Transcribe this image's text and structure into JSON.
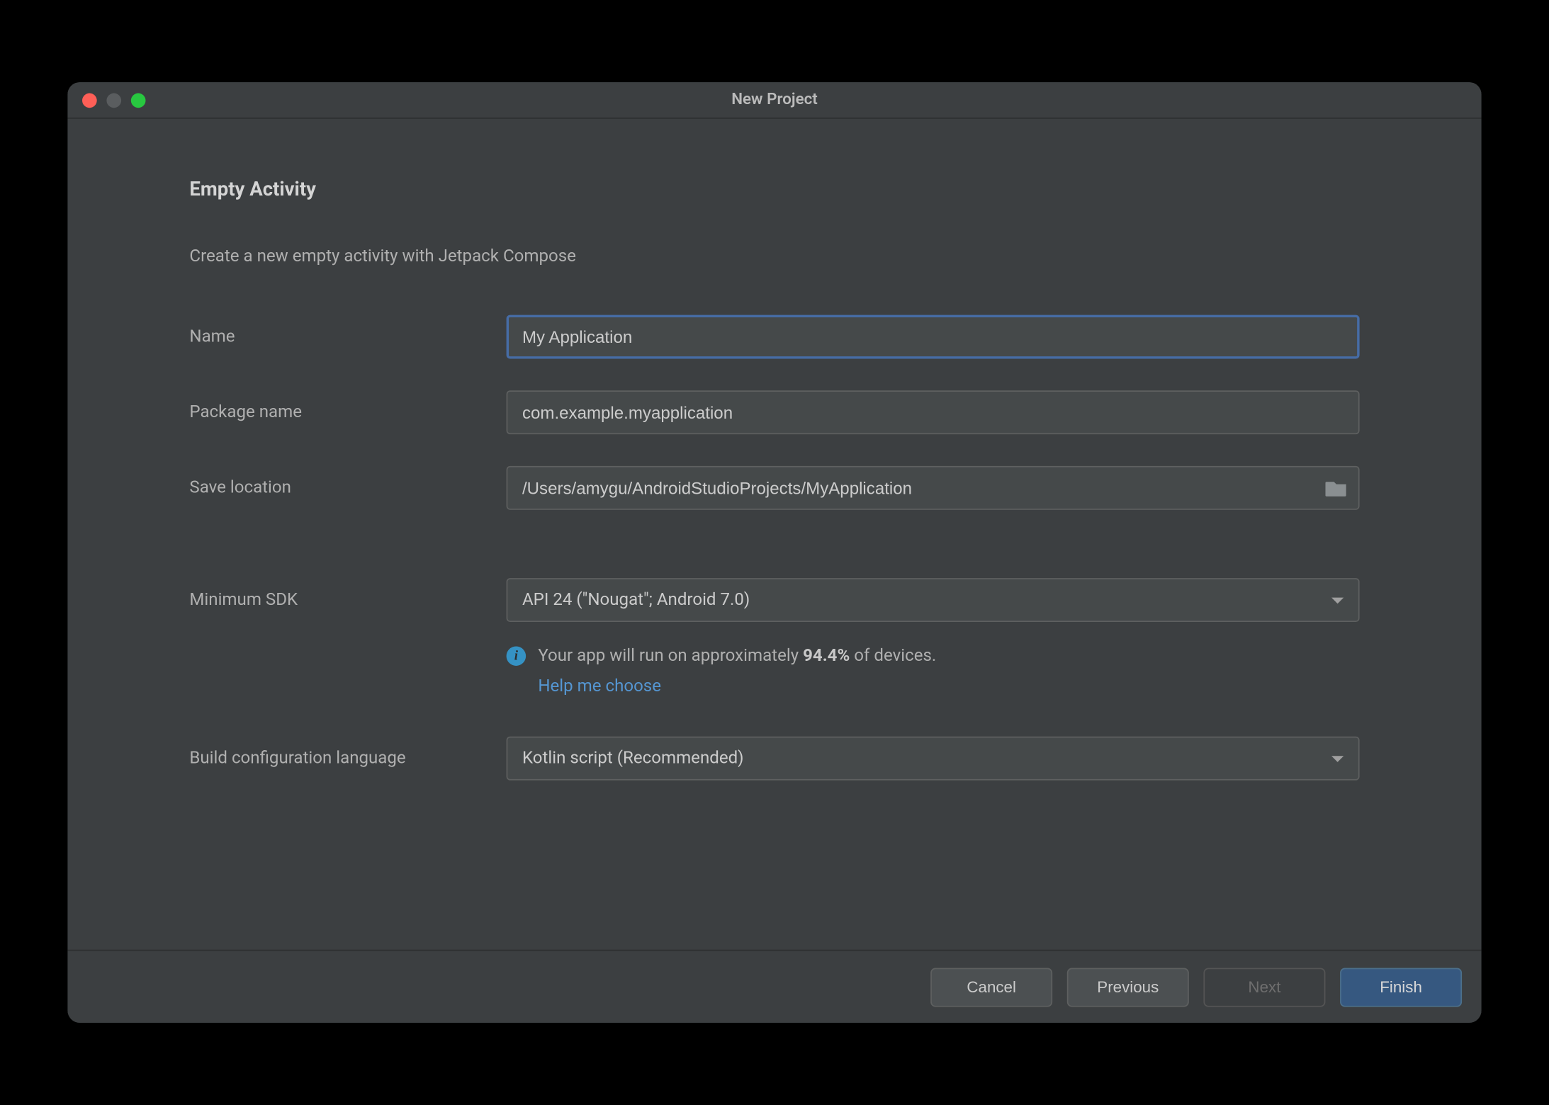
{
  "window": {
    "title": "New Project"
  },
  "header": {
    "heading": "Empty Activity",
    "description": "Create a new empty activity with Jetpack Compose"
  },
  "form": {
    "name": {
      "label": "Name",
      "value": "My Application"
    },
    "package_name": {
      "label": "Package name",
      "value": "com.example.myapplication"
    },
    "save_location": {
      "label": "Save location",
      "value": "/Users/amygu/AndroidStudioProjects/MyApplication"
    },
    "minimum_sdk": {
      "label": "Minimum SDK",
      "value": "API 24 (\"Nougat\"; Android 7.0)"
    },
    "build_lang": {
      "label": "Build configuration language",
      "value": "Kotlin script (Recommended)"
    }
  },
  "info": {
    "text_prefix": "Your app will run on approximately ",
    "percent": "94.4%",
    "text_suffix": " of devices.",
    "help_link": "Help me choose"
  },
  "footer": {
    "cancel": "Cancel",
    "previous": "Previous",
    "next": "Next",
    "finish": "Finish"
  }
}
